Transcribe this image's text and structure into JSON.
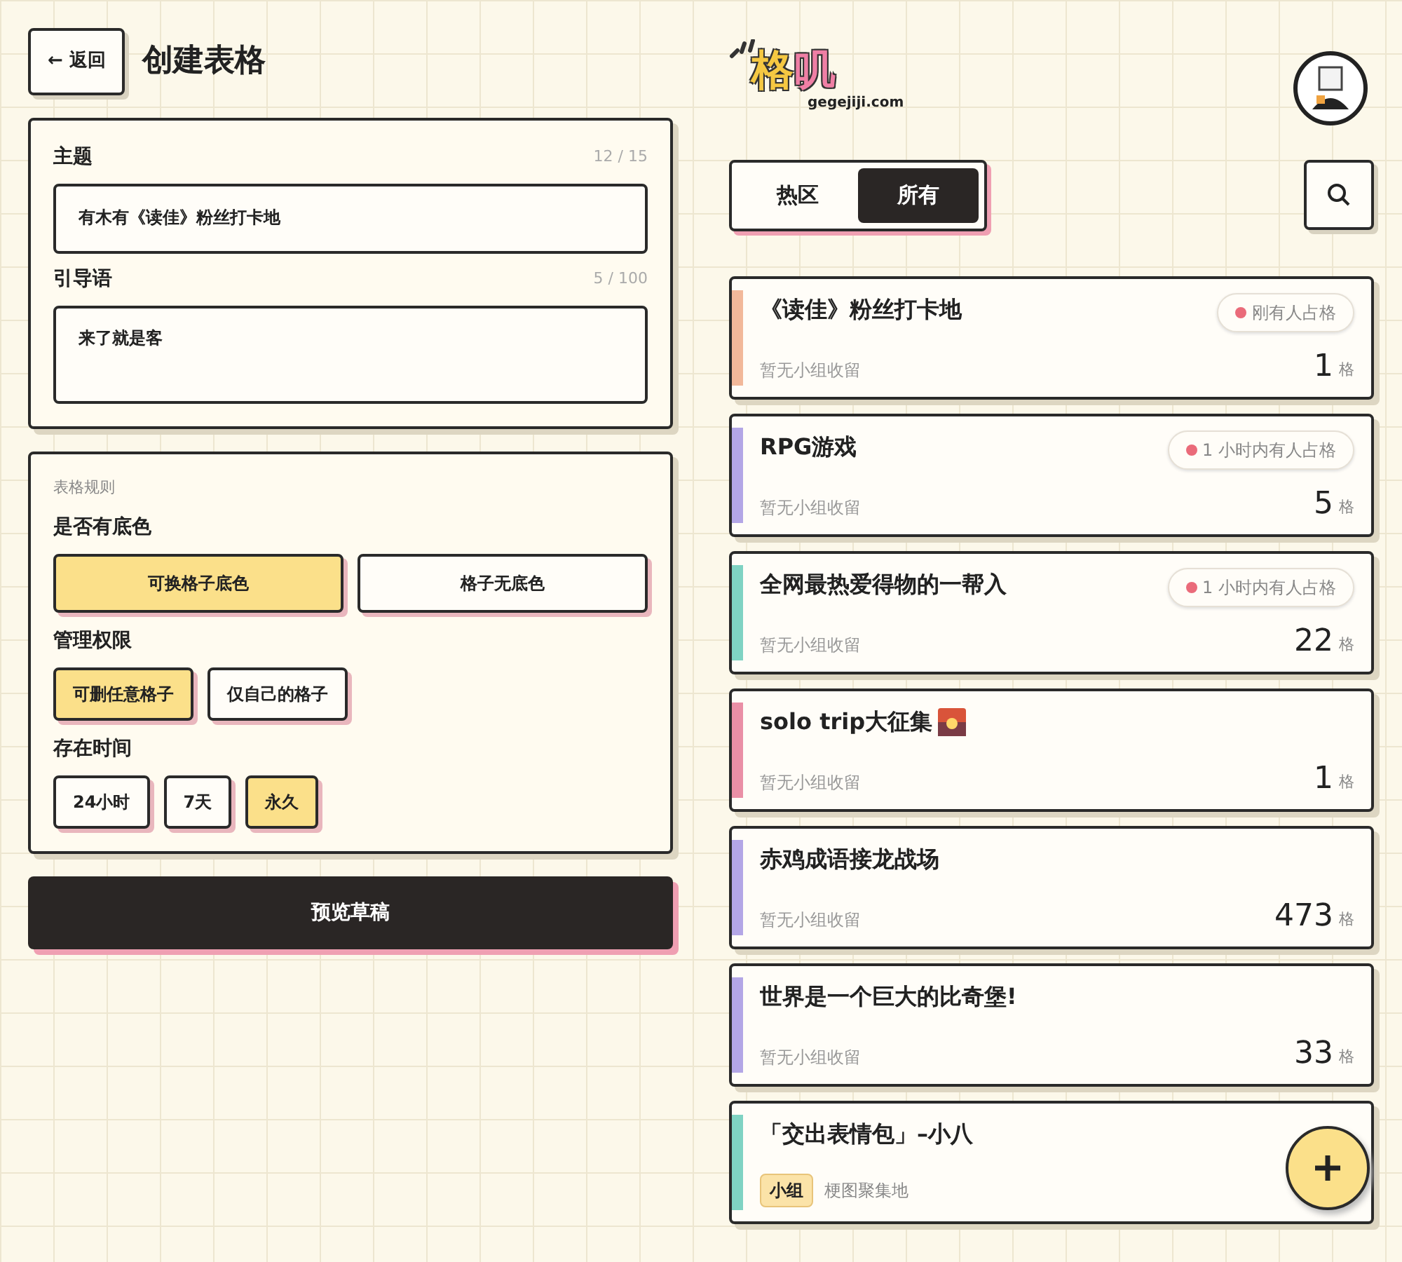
{
  "header": {
    "back": "← 返回",
    "title": "创建表格"
  },
  "form": {
    "fields": [
      {
        "label": "主题",
        "counter": "12 / 15",
        "value": "有木有《读佳》粉丝打卡地",
        "kind": "input"
      },
      {
        "label": "引导语",
        "counter": "5 / 100",
        "value": "来了就是客",
        "kind": "textarea"
      }
    ]
  },
  "rules": {
    "heading": "表格规则",
    "groups": [
      {
        "label": "是否有底色",
        "wide": true,
        "options": [
          {
            "label": "可换格子底色",
            "selected": true
          },
          {
            "label": "格子无底色",
            "selected": false
          }
        ]
      },
      {
        "label": "管理权限",
        "wide": false,
        "options": [
          {
            "label": "可删任意格子",
            "selected": true
          },
          {
            "label": "仅自己的格子",
            "selected": false
          }
        ]
      },
      {
        "label": "存在时间",
        "wide": false,
        "options": [
          {
            "label": "24小时",
            "selected": false
          },
          {
            "label": "7天",
            "selected": false
          },
          {
            "label": "永久",
            "selected": true
          }
        ]
      }
    ]
  },
  "preview_button": "预览草稿",
  "logo": {
    "mark_1": "格",
    "mark_2": "叽",
    "domain": "gegejiji.com"
  },
  "tabs": [
    {
      "label": "热区",
      "selected": false
    },
    {
      "label": "所有",
      "selected": true
    }
  ],
  "boards": [
    {
      "title": "《读佳》粉丝打卡地",
      "color": "#f2b89a",
      "badge": "刚有人占格",
      "kind": "plain",
      "subtitle": "暂无小组收留",
      "count": "1",
      "unit": "格"
    },
    {
      "title": "RPG游戏",
      "color": "#b3a6e6",
      "badge": "1 小时内有人占格",
      "kind": "plain",
      "subtitle": "暂无小组收留",
      "count": "5",
      "unit": "格"
    },
    {
      "title": "全网最热爱得物的一帮入",
      "color": "#7fd3c3",
      "badge": "1 小时内有人占格",
      "kind": "plain",
      "subtitle": "暂无小组收留",
      "count": "22",
      "unit": "格"
    },
    {
      "title": "solo trip大征集",
      "emoji": true,
      "color": "#ea8fa6",
      "kind": "plain",
      "subtitle": "暂无小组收留",
      "count": "1",
      "unit": "格"
    },
    {
      "title": "赤鸡成语接龙战场",
      "color": "#b3a6e6",
      "kind": "plain",
      "subtitle": "暂无小组收留",
      "count": "473",
      "unit": "格"
    },
    {
      "title": "世界是一个巨大的比奇堡!",
      "color": "#b3a6e6",
      "kind": "plain",
      "subtitle": "暂无小组收留",
      "count": "33",
      "unit": "格"
    },
    {
      "title": "「交出表情包」–小八",
      "color": "#7fd3c3",
      "kind": "group",
      "tag": "小组",
      "subtitle": "梗图聚集地"
    }
  ]
}
